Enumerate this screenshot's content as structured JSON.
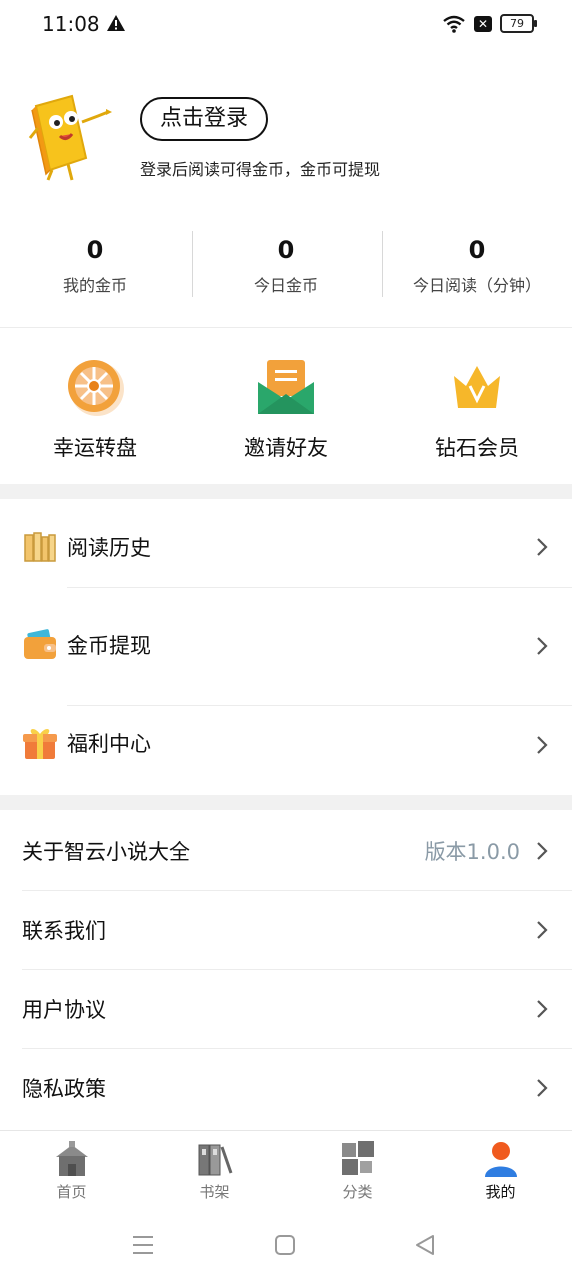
{
  "status_bar": {
    "time": "11:08",
    "battery": "79",
    "icons": [
      "warning-icon",
      "wifi-icon",
      "no-sim-icon",
      "battery-icon"
    ]
  },
  "profile": {
    "login_button": "点击登录",
    "login_hint": "登录后阅读可得金币，金币可提现",
    "mascot": "book-mascot-icon"
  },
  "stats": [
    {
      "value": "0",
      "label": "我的金币"
    },
    {
      "value": "0",
      "label": "今日金币"
    },
    {
      "value": "0",
      "label": "今日阅读（分钟）"
    }
  ],
  "features": [
    {
      "label": "幸运转盘",
      "icon": "lucky-wheel-icon"
    },
    {
      "label": "邀请好友",
      "icon": "invite-envelope-icon"
    },
    {
      "label": "钻石会员",
      "icon": "crown-icon"
    }
  ],
  "menu": [
    {
      "label": "阅读历史",
      "icon": "books-icon"
    },
    {
      "label": "金币提现",
      "icon": "wallet-icon"
    },
    {
      "label": "福利中心",
      "icon": "gift-icon"
    }
  ],
  "settings": [
    {
      "label": "关于智云小说大全",
      "value": "版本1.0.0"
    },
    {
      "label": "联系我们"
    },
    {
      "label": "用户协议"
    },
    {
      "label": "隐私政策"
    }
  ],
  "tabs": [
    {
      "label": "首页",
      "icon": "home-icon",
      "active": false
    },
    {
      "label": "书架",
      "icon": "bookshelf-icon",
      "active": false
    },
    {
      "label": "分类",
      "icon": "category-icon",
      "active": false
    },
    {
      "label": "我的",
      "icon": "profile-icon",
      "active": true
    }
  ],
  "colors": {
    "accent_orange": "#f2a13b",
    "accent_green": "#2aa76b",
    "crown_yellow": "#f6b72a",
    "version_text": "#8a9aa6",
    "section_gap": "#f1f1f1"
  }
}
